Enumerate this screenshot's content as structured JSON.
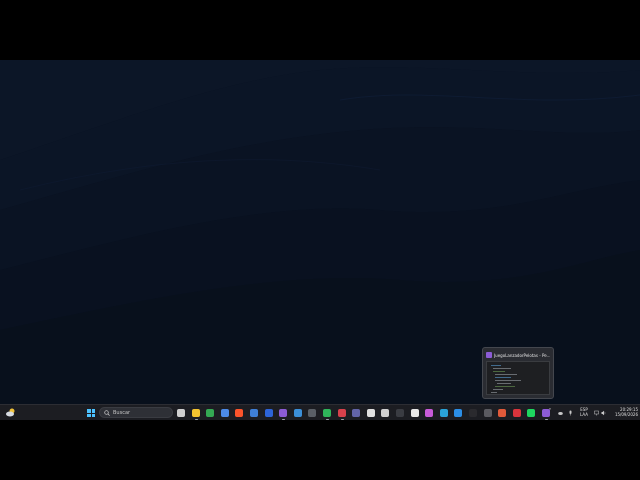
{
  "desktop": {
    "background_color": "#0a1220",
    "wave_colors": [
      "#0d1728",
      "#0b1424",
      "#09111e",
      "#0a1322"
    ]
  },
  "preview": {
    "title": "JuegoLanzadorPelotas - Pe...",
    "app_icon": "visual-studio-icon"
  },
  "taskbar": {
    "search_placeholder": "Buscar",
    "language_line1": "ESP",
    "language_line2": "LAA",
    "time": "20:29:15",
    "date": "15/09/2026",
    "pinned_apps": [
      {
        "name": "task-view-icon",
        "color": "#d0d0d0"
      },
      {
        "name": "file-explorer-icon",
        "color": "#f4c430"
      },
      {
        "name": "chrome-icon",
        "color": "#34a853"
      },
      {
        "name": "microsoft-store-icon",
        "color": "#4c8ae8"
      },
      {
        "name": "brave-icon",
        "color": "#fb542b"
      },
      {
        "name": "shield-app-icon",
        "color": "#3f7fd6"
      },
      {
        "name": "app-blue-icon",
        "color": "#2d64d8"
      },
      {
        "name": "visual-studio-icon",
        "color": "#8c5cd6"
      },
      {
        "name": "remote-desktop-icon",
        "color": "#3b8fd8"
      },
      {
        "name": "terminal-icon",
        "color": "#5a5f66"
      },
      {
        "name": "green-app-icon",
        "color": "#2fb45a"
      },
      {
        "name": "red-ring-icon",
        "color": "#d8414c"
      },
      {
        "name": "teams-icon",
        "color": "#6264a7"
      },
      {
        "name": "copilot-icon",
        "color": "#e0e0e0"
      },
      {
        "name": "github-icon",
        "color": "#d0d0d0"
      },
      {
        "name": "dark-app-icon",
        "color": "#3a3c42"
      },
      {
        "name": "chatgpt-icon",
        "color": "#e8e8e8"
      },
      {
        "name": "colorful-app-icon",
        "color": "#c85bd8"
      },
      {
        "name": "edge-icon",
        "color": "#2aa3d8"
      },
      {
        "name": "vscode-icon",
        "color": "#2b8ee6"
      },
      {
        "name": "dark-square-icon",
        "color": "#2a2a2e"
      },
      {
        "name": "gray-app-icon",
        "color": "#5a5a60"
      },
      {
        "name": "spark-icon",
        "color": "#e05a3a"
      },
      {
        "name": "red-box-icon",
        "color": "#d8343c"
      },
      {
        "name": "spotify-icon",
        "color": "#1ed760"
      },
      {
        "name": "visual-studio-2-icon",
        "color": "#8c5cd6"
      }
    ]
  }
}
